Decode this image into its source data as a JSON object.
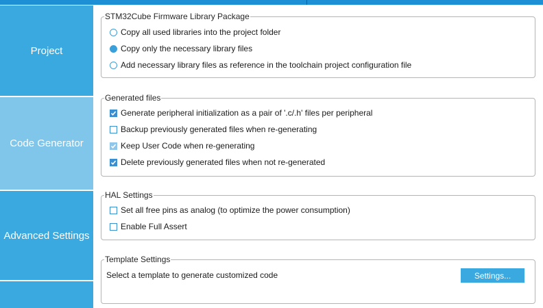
{
  "sidebar": {
    "items": [
      {
        "label": "Project",
        "active": false
      },
      {
        "label": "Code Generator",
        "active": true
      },
      {
        "label": "Advanced Settings",
        "active": false
      },
      {
        "label": "",
        "active": false
      }
    ]
  },
  "firmware": {
    "legend": "STM32Cube Firmware Library Package",
    "options": [
      {
        "label": "Copy all used libraries into the project folder",
        "selected": false
      },
      {
        "label": "Copy only the necessary library files",
        "selected": true
      },
      {
        "label": "Add necessary library files as reference in the toolchain project configuration file",
        "selected": false
      }
    ]
  },
  "generated": {
    "legend": "Generated files",
    "options": [
      {
        "label": "Generate peripheral initialization as a pair of '.c/.h' files per peripheral",
        "checked": true
      },
      {
        "label": "Backup previously generated files when re-generating",
        "checked": false
      },
      {
        "label": "Keep User Code when re-generating",
        "checked": true
      },
      {
        "label": "Delete previously generated files when not re-generated",
        "checked": true
      }
    ]
  },
  "hal": {
    "legend": "HAL Settings",
    "options": [
      {
        "label": "Set all free pins as analog (to optimize the power consumption)",
        "checked": false
      },
      {
        "label": "Enable Full Assert",
        "checked": false
      }
    ]
  },
  "template": {
    "legend": "Template Settings",
    "text": "Select a template to generate customized code",
    "button_label": "Settings..."
  },
  "colors": {
    "accent": "#3aa9e0",
    "active_nav": "#7fc6ea",
    "top_bar": "#1d8fd4"
  }
}
